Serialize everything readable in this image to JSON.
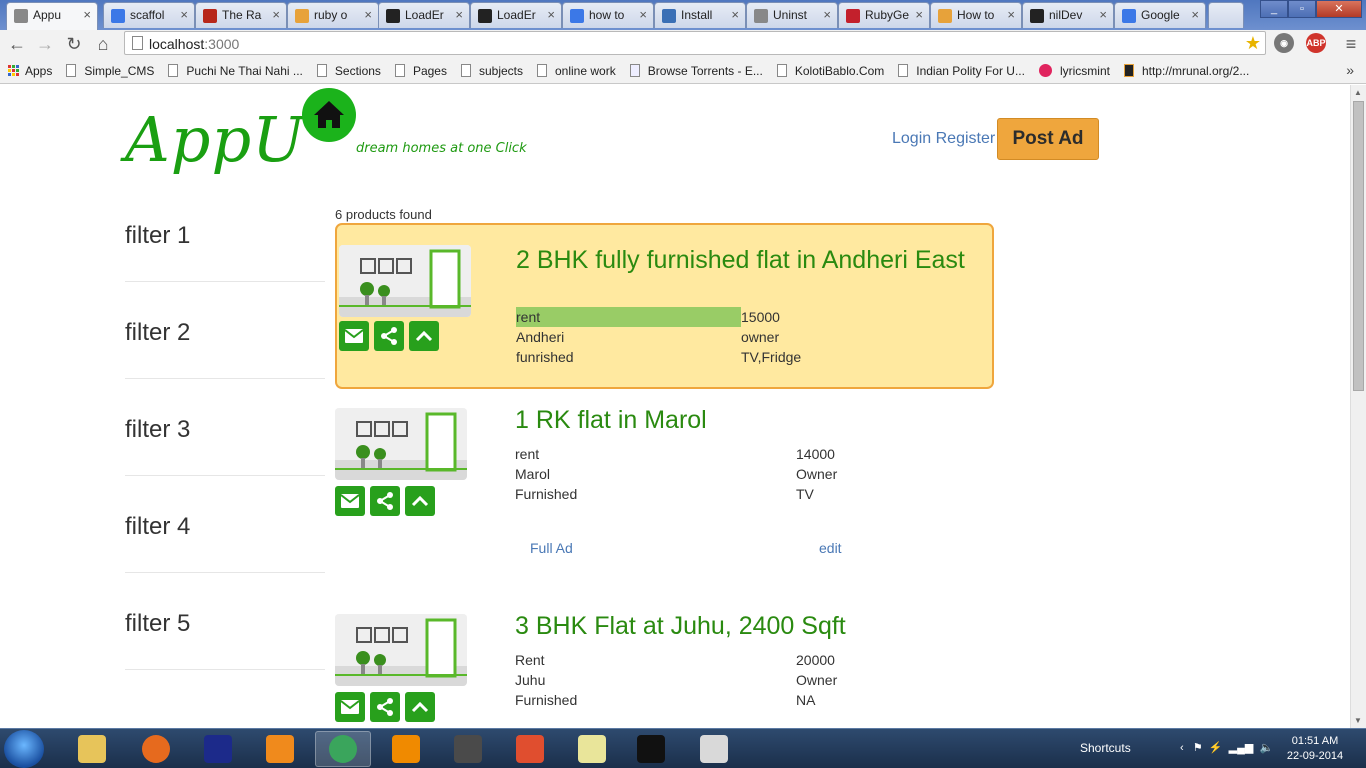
{
  "browser": {
    "tabs": [
      {
        "label": "Appu",
        "active": true,
        "icon": "page-icon",
        "color": "#888888"
      },
      {
        "label": "scaffol",
        "icon": "google-icon",
        "color": "#3b78e7"
      },
      {
        "label": "The Ra",
        "icon": "rails-icon",
        "color": "#b7271b"
      },
      {
        "label": "ruby o",
        "icon": "stackoverflow-icon",
        "color": "#e7a23a"
      },
      {
        "label": "LoadEr",
        "icon": "github-icon",
        "color": "#222222"
      },
      {
        "label": "LoadEr",
        "icon": "github-icon",
        "color": "#222222"
      },
      {
        "label": "how to",
        "icon": "google-icon",
        "color": "#3b78e7"
      },
      {
        "label": "Install",
        "icon": "jetbrains-icon",
        "color": "#3a6fb5"
      },
      {
        "label": "Uninst",
        "icon": "page-icon",
        "color": "#888888"
      },
      {
        "label": "RubyGe",
        "icon": "rubygems-icon",
        "color": "#c3202c"
      },
      {
        "label": "How to",
        "icon": "stackoverflow-icon",
        "color": "#e7a23a"
      },
      {
        "label": "nilDev",
        "icon": "github-icon",
        "color": "#222222"
      },
      {
        "label": "Google",
        "icon": "google-icon",
        "color": "#3b78e7"
      }
    ],
    "tab_close_glyph": "×",
    "url_host": "localhost",
    "url_port": ":3000",
    "abp_label": "ABP",
    "bookmarks": [
      {
        "label": "Apps",
        "icon": "apps-grid-icon"
      },
      {
        "label": "Simple_CMS",
        "icon": "page-icon"
      },
      {
        "label": "Puchi Ne Thai Nahi ...",
        "icon": "page-icon"
      },
      {
        "label": "Sections",
        "icon": "page-icon"
      },
      {
        "label": "Pages",
        "icon": "page-icon"
      },
      {
        "label": "subjects",
        "icon": "page-icon"
      },
      {
        "label": "online work",
        "icon": "page-icon"
      },
      {
        "label": "Browse Torrents - E...",
        "icon": "torrent-icon"
      },
      {
        "label": "KolotiBablo.Com",
        "icon": "page-icon"
      },
      {
        "label": "Indian Polity For U...",
        "icon": "page-icon"
      },
      {
        "label": "lyricsmint",
        "icon": "lyricsmint-icon"
      },
      {
        "label": "http://mrunal.org/2...",
        "icon": "mrunal-icon"
      }
    ],
    "bookmarks_more": "»"
  },
  "site": {
    "logo": "AppU",
    "tagline": "dream homes at one Click",
    "login": "Login",
    "register": "Register",
    "post_ad": "Post Ad",
    "brand_color": "#1a9f12",
    "accent_color": "#efa63d"
  },
  "filters": [
    "filter 1",
    "filter 2",
    "filter 3",
    "filter 4",
    "filter 5"
  ],
  "results": {
    "count_text": "6 products found",
    "listings": [
      {
        "title": "2 BHK fully furnished flat in Andheri East",
        "highlighted": true,
        "rows": [
          {
            "k": "rent",
            "v": "15000"
          },
          {
            "k": "Andheri",
            "v": "owner"
          },
          {
            "k": "funrished",
            "v": "TV,Fridge"
          }
        ]
      },
      {
        "title": "1 RK flat in Marol",
        "highlighted": false,
        "rows": [
          {
            "k": "rent",
            "v": "14000"
          },
          {
            "k": "Marol",
            "v": "Owner"
          },
          {
            "k": "Furnished",
            "v": "TV"
          }
        ],
        "full_ad": "Full Ad",
        "edit": "edit"
      },
      {
        "title": "3 BHK Flat at Juhu, 2400 Sqft",
        "highlighted": false,
        "rows": [
          {
            "k": "Rent",
            "v": "20000"
          },
          {
            "k": "Juhu",
            "v": "Owner"
          },
          {
            "k": "Furnished",
            "v": "NA"
          }
        ]
      }
    ]
  },
  "taskbar": {
    "apps": [
      {
        "name": "explorer-icon",
        "color": "#e7c45a"
      },
      {
        "name": "firefox-icon",
        "color": "#e66a1e"
      },
      {
        "name": "winamp-icon",
        "color": "#1c2a8a"
      },
      {
        "name": "media-player-icon",
        "color": "#f08a1c"
      },
      {
        "name": "chrome-icon",
        "color": "#3aa55c",
        "active": true
      },
      {
        "name": "vlc-icon",
        "color": "#f08a00"
      },
      {
        "name": "sublime-icon",
        "color": "#4a4a4a"
      },
      {
        "name": "git-icon",
        "color": "#e04e2f"
      },
      {
        "name": "sticky-notes-icon",
        "color": "#e9e59a"
      },
      {
        "name": "cmd-icon",
        "color": "#111111"
      },
      {
        "name": "snipping-tool-icon",
        "color": "#d9d9d9"
      }
    ],
    "shortcuts": "Shortcuts",
    "time": "01:51 AM",
    "date": "22-09-2014"
  }
}
